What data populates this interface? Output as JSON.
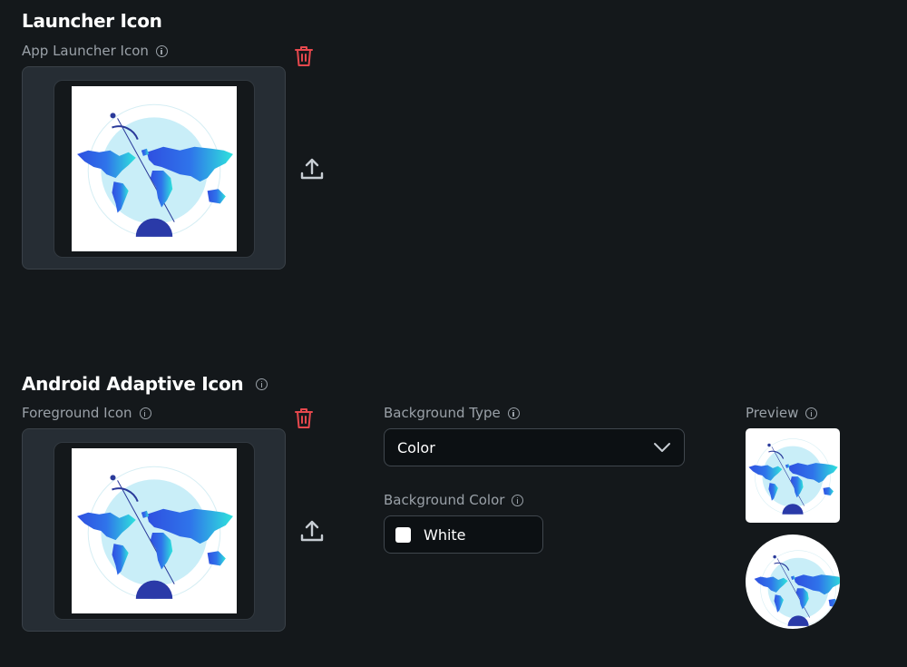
{
  "launcher": {
    "title": "Launcher Icon",
    "app_icon_label": "App Launcher Icon"
  },
  "adaptive": {
    "title": "Android Adaptive Icon",
    "foreground_label": "Foreground Icon",
    "background_type_label": "Background Type",
    "background_type_value": "Color",
    "background_color_label": "Background Color",
    "background_color_value": "White",
    "preview_label": "Preview"
  },
  "icons": {
    "delete": "trash-icon",
    "upload": "upload-icon",
    "info": "info-icon",
    "dropdown": "chevron-down-icon"
  },
  "colors": {
    "background": "#14181b",
    "panel": "#262d34",
    "delete": "#e5484d",
    "swatch": "#ffffff"
  }
}
